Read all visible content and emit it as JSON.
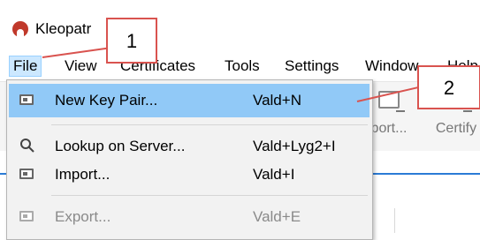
{
  "window": {
    "title": "Kleopatr"
  },
  "menubar": {
    "items": [
      "File",
      "View",
      "Certificates",
      "Tools",
      "Settings",
      "Window",
      "Help"
    ],
    "active": "File"
  },
  "toolbar": {
    "buttons": [
      {
        "label": "port...",
        "icon": "import-icon"
      },
      {
        "label": "Certify",
        "icon": "certify-icon"
      }
    ]
  },
  "file_menu": {
    "items": [
      {
        "label": "New Key Pair...",
        "shortcut": "Vald+N",
        "icon": "new-key-pair-icon",
        "highlighted": true,
        "enabled": true
      },
      {
        "label": "Lookup on Server...",
        "shortcut": "Vald+Lyg2+I",
        "icon": "search-icon",
        "highlighted": false,
        "enabled": true
      },
      {
        "label": "Import...",
        "shortcut": "Vald+I",
        "icon": "import-icon",
        "highlighted": false,
        "enabled": true
      },
      {
        "label": "Export...",
        "shortcut": "Vald+E",
        "icon": "export-icon",
        "highlighted": false,
        "enabled": false
      }
    ]
  },
  "callouts": {
    "first": "1",
    "second": "2"
  },
  "colors": {
    "highlight": "#91c9f7",
    "callout": "#d9534f",
    "menu_active": "#cce8ff"
  }
}
